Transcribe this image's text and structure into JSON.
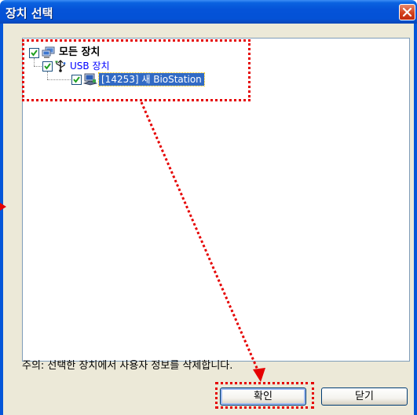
{
  "window": {
    "title": "장치 선택",
    "close_label": "×"
  },
  "tree": {
    "root": {
      "label": "모든 장치",
      "checked": true,
      "icon": "computers-icon"
    },
    "group": {
      "label": "USB 장치",
      "checked": true,
      "icon": "usb-icon"
    },
    "device": {
      "label": "[14253] 새 BioStation",
      "checked": true,
      "selected": true,
      "icon": "device-icon"
    }
  },
  "notice": "주의: 선택한 장치에서 사용자 정보를 삭제합니다.",
  "buttons": {
    "ok": "확인",
    "close": "닫기"
  },
  "colors": {
    "titlebar": "#0553d8",
    "selection": "#316ac5",
    "annotation": "#e50000",
    "group_text": "#0000ff"
  }
}
